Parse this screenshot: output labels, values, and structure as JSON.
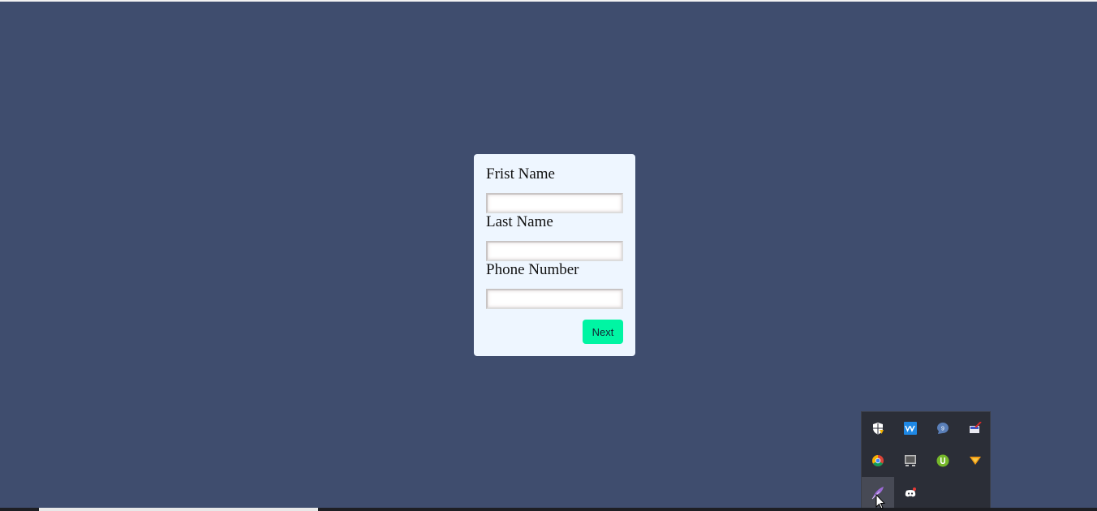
{
  "form": {
    "fields": [
      {
        "label": "Frist Name",
        "value": "",
        "placeholder": ""
      },
      {
        "label": "Last Name",
        "value": "",
        "placeholder": ""
      },
      {
        "label": "Phone Number",
        "value": "",
        "placeholder": ""
      }
    ],
    "next_label": "Next"
  },
  "tray": {
    "icons": [
      {
        "name": "windows-security-icon",
        "badge": ""
      },
      {
        "name": "waves-audio-icon",
        "badge": ""
      },
      {
        "name": "chat-bubble-icon",
        "badge": "9"
      },
      {
        "name": "display-tool-icon",
        "badge": ""
      },
      {
        "name": "chrome-icon",
        "badge": ""
      },
      {
        "name": "monitor-icon",
        "badge": ""
      },
      {
        "name": "utorrent-icon",
        "badge": ""
      },
      {
        "name": "vlc-icon",
        "badge": ""
      },
      {
        "name": "feather-pen-icon",
        "badge": ""
      },
      {
        "name": "discord-icon",
        "badge": ""
      }
    ]
  },
  "colors": {
    "background": "#3f4d6e",
    "card": "#eef6ff",
    "accent": "#00f5a3",
    "tray": "#2b2e37"
  }
}
